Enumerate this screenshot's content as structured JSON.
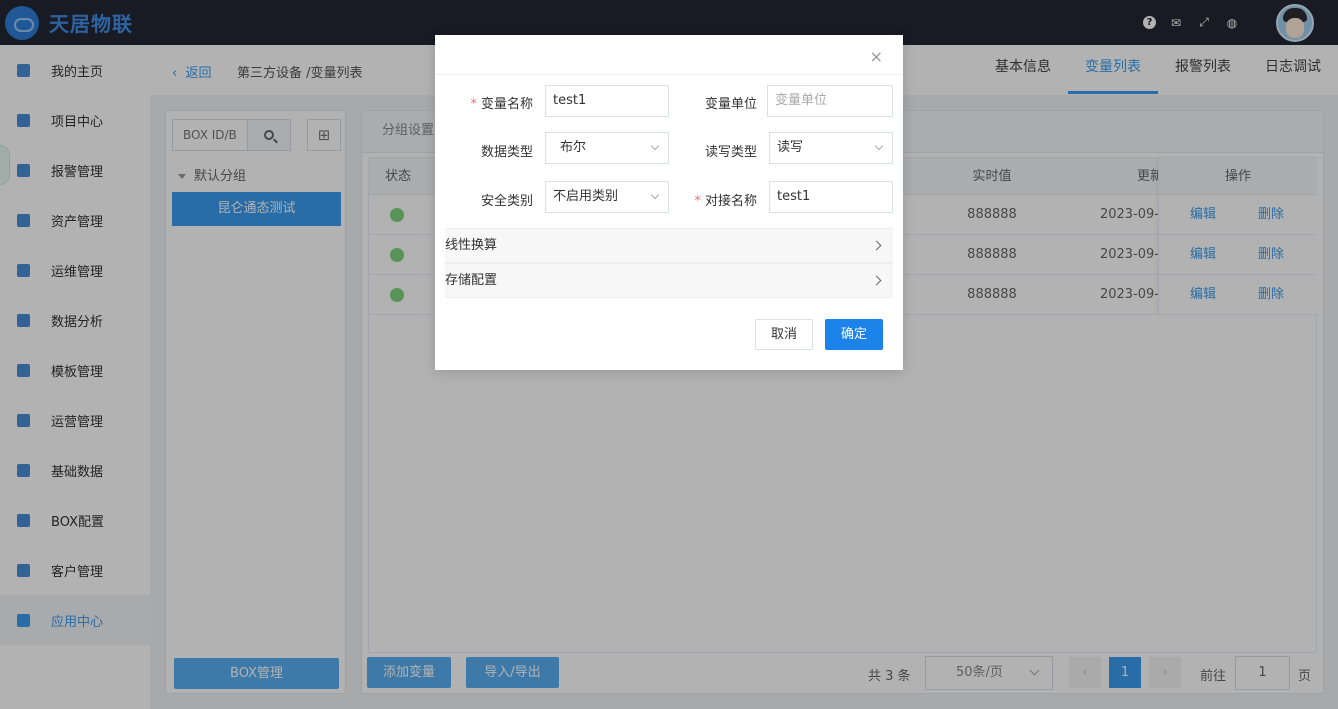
{
  "header": {
    "logo_text": "天居物联",
    "icons": [
      "help-icon",
      "mail-icon",
      "fullscreen-icon",
      "globe-icon"
    ]
  },
  "sidebar": {
    "items": [
      {
        "label": "我的主页",
        "icon": "home-icon"
      },
      {
        "label": "项目中心",
        "icon": "project-icon"
      },
      {
        "label": "报警管理",
        "icon": "bell-icon"
      },
      {
        "label": "资产管理",
        "icon": "asset-icon"
      },
      {
        "label": "运维管理",
        "icon": "gear-icon"
      },
      {
        "label": "数据分析",
        "icon": "monitor-icon"
      },
      {
        "label": "模板管理",
        "icon": "template-icon"
      },
      {
        "label": "运营管理",
        "icon": "shield-icon"
      },
      {
        "label": "基础数据",
        "icon": "data-icon"
      },
      {
        "label": "BOX配置",
        "icon": "box-icon"
      },
      {
        "label": "客户管理",
        "icon": "users-icon"
      },
      {
        "label": "应用中心",
        "icon": "apps-icon",
        "active": true
      }
    ]
  },
  "topbar": {
    "back": "返回",
    "breadcrumb": "第三方设备 /变量列表",
    "tabs": [
      "基本信息",
      "变量列表",
      "报警列表",
      "日志调试"
    ],
    "active_tab": "变量列表"
  },
  "group_panel": {
    "search_placeholder": "BOX ID/B",
    "tree_parent": "默认分组",
    "tree_node": "昆仑通态测试",
    "box_button": "BOX管理"
  },
  "table": {
    "panel_title": "分组设置",
    "headers": {
      "status": "状态",
      "realtime": "实时值",
      "updated": "更新",
      "operation": "操作"
    },
    "rows": [
      {
        "realtime": "888888",
        "updated": "2023-09-",
        "edit": "编辑",
        "delete": "删除"
      },
      {
        "realtime": "888888",
        "updated": "2023-09-",
        "edit": "编辑",
        "delete": "删除"
      },
      {
        "realtime": "888888",
        "updated": "2023-09-",
        "edit": "编辑",
        "delete": "删除"
      }
    ],
    "status_color": "#7ed57e"
  },
  "footer": {
    "add_button": "添加变量",
    "import_button": "导入/导出",
    "total": "共 3 条",
    "page_size": "50条/页",
    "prev": "‹",
    "current_page": "1",
    "next": "›",
    "goto_label": "前往",
    "goto_value": "1",
    "goto_suffix": "页"
  },
  "modal": {
    "close": "×",
    "var_name_label": "变量名称",
    "var_name_value": "test1",
    "var_unit_label": "变量单位",
    "var_unit_placeholder": "变量单位",
    "data_type_label": "数据类型",
    "data_type_value": "布尔",
    "rw_type_label": "读写类型",
    "rw_type_value": "读写",
    "safety_label": "安全类别",
    "safety_value": "不启用类别",
    "map_name_label": "对接名称",
    "map_name_value": "test1",
    "linear_section": "线性换算",
    "storage_section": "存储配置",
    "cancel": "取消",
    "confirm": "确定",
    "required_mark": "*"
  },
  "colors": {
    "accent": "#3a9df0",
    "header_bg": "#232733",
    "confirm": "#1c83ea",
    "required": "#f56c6c"
  }
}
